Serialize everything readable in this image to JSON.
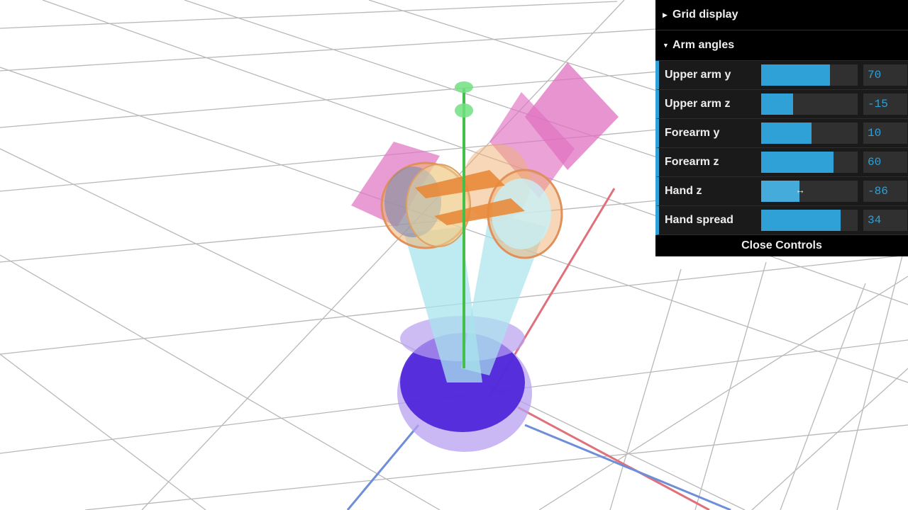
{
  "scene": {
    "colors": {
      "background": "#ffffff",
      "grid": "#b8b8b8",
      "x_axis": "#e0707a",
      "y_axis": "#44c04a",
      "z_axis": "#6e8ed8",
      "base_outer": "#b8a0f0",
      "base_inner": "#4a1fd8",
      "arm": "#a8e4ec",
      "forearm_pink": "#e070c0",
      "joint_orange": "#f0b070",
      "finger": "#e88a3a"
    }
  },
  "gui": {
    "folders": [
      {
        "title": "Grid display",
        "state": "collapsed-icon"
      },
      {
        "title": "Arm angles",
        "state": "expanded-icon"
      }
    ],
    "controllers": [
      {
        "label": "Upper arm y",
        "value": "70",
        "fraction": 0.71
      },
      {
        "label": "Upper arm z",
        "value": "-15",
        "fraction": 0.33
      },
      {
        "label": "Forearm y",
        "value": "10",
        "fraction": 0.52
      },
      {
        "label": "Forearm z",
        "value": "60",
        "fraction": 0.75
      },
      {
        "label": "Hand z",
        "value": "-86",
        "fraction": 0.4
      },
      {
        "label": "Hand spread",
        "value": "34",
        "fraction": 0.82
      }
    ],
    "close_label": "Close Controls"
  }
}
